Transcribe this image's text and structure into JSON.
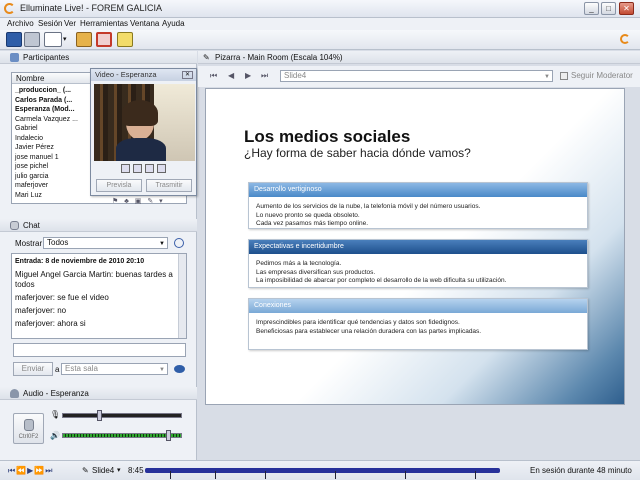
{
  "window": {
    "title": "Elluminate Live! - FOREM GALICIA",
    "minimize": "_",
    "restore": "□",
    "close": "✕"
  },
  "menu": [
    "Archivo",
    "Sesión",
    "Ver",
    "Herramientas",
    "Ventana",
    "Ayuda"
  ],
  "participants": {
    "header": "Participantes",
    "column": "Nombre",
    "rows": [
      {
        "name": "_produccion_ (...",
        "bold": true
      },
      {
        "name": "Carlos Parada (...",
        "bold": true
      },
      {
        "name": "Esperanza (Mod...",
        "bold": true
      },
      {
        "name": "Carmela Vazquez ...",
        "bold": false
      },
      {
        "name": "Gabriel",
        "bold": false
      },
      {
        "name": "Indalecio",
        "bold": false
      },
      {
        "name": "Javier Pérez",
        "bold": false
      },
      {
        "name": "jose manuel 1",
        "bold": false
      },
      {
        "name": "jose pichel",
        "bold": false
      },
      {
        "name": "julio garcia",
        "bold": false
      },
      {
        "name": "maferjover",
        "bold": false
      },
      {
        "name": "Mari Luz",
        "bold": false
      }
    ]
  },
  "video": {
    "title": "Video - Esperanza",
    "preview": "Previsla",
    "transmit": "Trasmitir"
  },
  "chat": {
    "header": "Chat",
    "show_label": "Mostrar",
    "filter": "Todos",
    "messages": [
      {
        "text": "Entrada: 8 de noviembre de 2010 20:10",
        "head": true
      },
      {
        "text": "Miguel Angel Garcia Martin: buenas tardes a todos",
        "head": false
      },
      {
        "text": "maferjover: se fue el video",
        "head": false
      },
      {
        "text": "maferjover: no",
        "head": false
      },
      {
        "text": "maferjover: ahora si",
        "head": false
      }
    ],
    "send": "Enviar",
    "to_label": "a",
    "target": "Esta sala"
  },
  "audio": {
    "header": "Audio - Esperanza",
    "button": "Ctrl0F2",
    "mic_level": 0.3,
    "speaker_level": 0.9
  },
  "whiteboard": {
    "header": "Pizarra - Main Room (Escala 104%)",
    "page_select": "Slide4",
    "follow_label": "Seguir Moderator",
    "slide_title": "Los medios sociales",
    "slide_subtitle": "¿Hay forma de saber hacia dónde vamos?",
    "sections": [
      {
        "title": "Desarrollo vertiginoso",
        "lines": [
          "Aumento de los servicios de la nube, la telefonía móvil y del número usuarios.",
          "Lo nuevo pronto se queda obsoleto.",
          "Cada vez pasamos más tiempo online."
        ]
      },
      {
        "title": "Expectativas e incertidumbre",
        "lines": [
          "Pedimos más a la tecnología.",
          "Las empresas diversifican sus productos.",
          "La imposibilidad de abarcar por completo el desarrollo de la web dificulta su utilización."
        ]
      },
      {
        "title": "Conexiones",
        "lines": [
          "Imprescindibles para identificar qué tendencias y datos son fidedignos.",
          "Beneficiosas para establecer una relación duradera con las partes implicadas."
        ]
      }
    ]
  },
  "statusbar": {
    "slide": "Slide4",
    "time": "8:45",
    "session": "En sesión durante 48 minuto"
  }
}
